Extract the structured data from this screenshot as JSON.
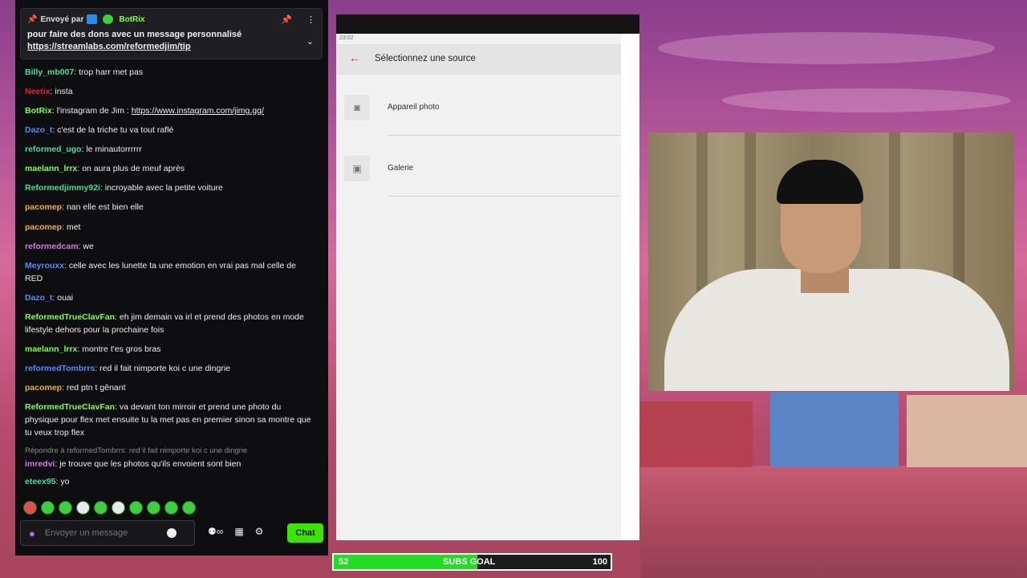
{
  "pinned": {
    "sent_by_label": "Envoyé par",
    "sender": "BotRix",
    "message": "pour faire des dons avec un message personnalisé",
    "link": "https://streamlabs.com/reformedjim/tip"
  },
  "chat_messages": [
    {
      "user": "Billy_mb007",
      "color": "#3fe0a0",
      "text": "trop harr met pas"
    },
    {
      "user": "Neetix",
      "color": "#e8203c",
      "text": "insta"
    },
    {
      "user": "BotRix",
      "color": "#7fff4a",
      "text": "l'instagram de Jim : ",
      "link": "https://www.instagram.com/jimg.gg/"
    },
    {
      "user": "Dazo_t",
      "color": "#4f8cff",
      "text": "c'est de la triche tu va tout raflé"
    },
    {
      "user": "reformed_ugo",
      "color": "#3fe0a0",
      "text": "le minautorrrrrr"
    },
    {
      "user": "maelann_lrrx",
      "color": "#7fff4a",
      "text": "on aura plus de meuf après"
    },
    {
      "user": "Reformedjimmy92i",
      "color": "#3fe0a0",
      "text": "incroyable avec la petite voiture"
    },
    {
      "user": "pacomep",
      "color": "#f0b030",
      "text": "nan elle est bien elle"
    },
    {
      "user": "pacomep",
      "color": "#f0b030",
      "text": "met"
    },
    {
      "user": "reformedcam",
      "color": "#d07ae8",
      "text": "we"
    },
    {
      "user": "Meyrouxx",
      "color": "#4f8cff",
      "text": "celle avec les lunette ta une emotion en vrai pas mal celle de RED"
    },
    {
      "user": "Dazo_t",
      "color": "#4f8cff",
      "text": "ouai"
    },
    {
      "user": "ReformedTrueClavFan",
      "color": "#7fff4a",
      "text": "eh jim demain va irl et prend des photos en mode lifestyle dehors pour la prochaine fois"
    },
    {
      "user": "maelann_lrrx",
      "color": "#7fff4a",
      "text": "montre t'es gros bras"
    },
    {
      "user": "reformedTombrrs",
      "color": "#4f8cff",
      "text": "red il fait nimporte koi c une dingrie"
    },
    {
      "user": "pacomep",
      "color": "#f0b030",
      "text": "red ptn t gênant"
    },
    {
      "user": "ReformedTrueClavFan",
      "color": "#7fff4a",
      "text": "va devant ton mirroir et prend une photo du physique pour flex met ensuite tu la met pas en premier sinon sa montre que tu veux trop flex"
    },
    {
      "reply_to": "Répondre à reformedTombrrs: red il fait nimporte koi c une dingrie",
      "user": "imredvi",
      "color": "#d07ae8",
      "text": "je trouve que les photos qu'ils envoient sont bien"
    },
    {
      "user": "eteex95",
      "color": "#3fe0a0",
      "text": "yo"
    }
  ],
  "chat_input": {
    "placeholder": "Envoyer un message",
    "send_label": "Chat"
  },
  "phone": {
    "time": "23:02",
    "title": "Sélectionnez une source",
    "sources": [
      "Appareil photo",
      "Galerie"
    ]
  },
  "goal": {
    "current": "52",
    "label": "SUBS GOAL",
    "target": "100",
    "progress": 0.52
  }
}
